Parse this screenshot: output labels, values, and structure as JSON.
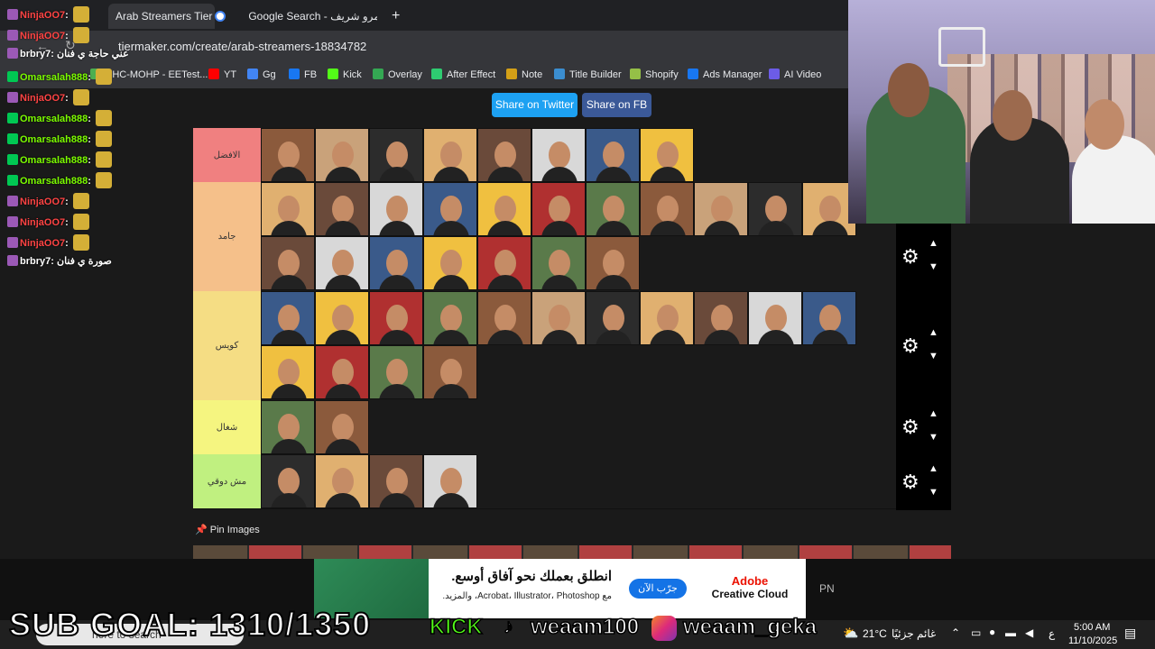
{
  "browser": {
    "tabs": [
      {
        "label": "Arab Streamers Tier Li"
      },
      {
        "label": "Google Search - عمرو شريف"
      }
    ],
    "new_tab_symbol": "+",
    "url": "tiermaker.com/create/arab-streamers-18834782",
    "bookmarks": [
      {
        "label": "EHC-MOHP - EETest...",
        "color": "#4caf50"
      },
      {
        "label": "YT",
        "color": "#ff0000"
      },
      {
        "label": "Gg",
        "color": "#4285f4"
      },
      {
        "label": "FB",
        "color": "#1877f2"
      },
      {
        "label": "Kick",
        "color": "#53fc18"
      },
      {
        "label": "Overlay",
        "color": "#34a853"
      },
      {
        "label": "After Effect",
        "color": "#2ecc71"
      },
      {
        "label": "Note",
        "color": "#d4a017"
      },
      {
        "label": "Title Builder",
        "color": "#3b8ed0"
      },
      {
        "label": "Shopify",
        "color": "#95bf47"
      },
      {
        "label": "Ads Manager",
        "color": "#1877f2"
      },
      {
        "label": "AI Video",
        "color": "#6c5ce7"
      }
    ]
  },
  "page": {
    "share_twitter": "Share on Twitter",
    "share_fb": "Share on FB",
    "pin_images": "Pin Images",
    "tiers": [
      {
        "label": "الافضل",
        "color": "#f08080",
        "tiles": 8
      },
      {
        "label": "جامد",
        "color": "#f5c08a",
        "tiles": 18
      },
      {
        "label": "كويس",
        "color": "#f5dd84",
        "tiles": 15
      },
      {
        "label": "شغال",
        "color": "#f5f580",
        "tiles": 2
      },
      {
        "label": "مش دوقي",
        "color": "#c0f080",
        "tiles": 4
      }
    ]
  },
  "chat": [
    {
      "user": "NinjaOO7",
      "msg": "",
      "color": "#ff4444"
    },
    {
      "user": "NinjaOO7",
      "msg": "",
      "color": "#ff4444"
    },
    {
      "user": "brbry7",
      "msg": "عني حاجة ي فنان",
      "color": "#ffffff"
    },
    {
      "user": "Omarsalah888",
      "msg": "",
      "color": "#7cfc00"
    },
    {
      "user": "NinjaOO7",
      "msg": "",
      "color": "#ff4444"
    },
    {
      "user": "Omarsalah888",
      "msg": "",
      "color": "#7cfc00"
    },
    {
      "user": "Omarsalah888",
      "msg": "",
      "color": "#7cfc00"
    },
    {
      "user": "Omarsalah888",
      "msg": "",
      "color": "#7cfc00"
    },
    {
      "user": "Omarsalah888",
      "msg": "",
      "color": "#7cfc00"
    },
    {
      "user": "NinjaOO7",
      "msg": "",
      "color": "#ff4444"
    },
    {
      "user": "NinjaOO7",
      "msg": "",
      "color": "#ff4444"
    },
    {
      "user": "NinjaOO7",
      "msg": "",
      "color": "#ff4444"
    },
    {
      "user": "brbry7",
      "msg": "صورة ي فنان",
      "color": "#ffffff"
    }
  ],
  "ad": {
    "headline": "انطلق بعملك نحو آفاق أوسع.",
    "sub": "مع Acrobat، Illustrator، Photoshop، والمزيد.",
    "cta": "جرّب الآن",
    "brand_line1": "Adobe",
    "brand_line2": "Creative Cloud",
    "tag": "PN"
  },
  "overlay": {
    "sub_goal": "SUB GOAL: 1310/1350",
    "kick": "KICK",
    "kick_handle": "weaam100",
    "ig_handle": "weaam_geka"
  },
  "taskbar": {
    "search": "here to search",
    "weather_temp": "21°C",
    "weather_text": "غائم جزئيًا",
    "lang": "ع",
    "time": "5:00 AM",
    "date": "11/10/2025"
  }
}
